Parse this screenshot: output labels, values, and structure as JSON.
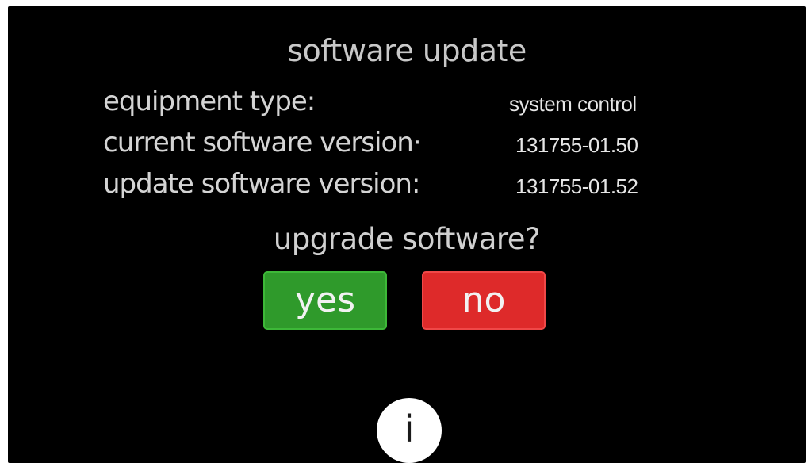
{
  "screen": {
    "title": "software update",
    "prompt": "upgrade software?"
  },
  "details": [
    {
      "label": "equipment type:",
      "value": "system control"
    },
    {
      "label": "current software version·",
      "value": "131755-01.50"
    },
    {
      "label": "update software version:",
      "value": "131755-01.52"
    }
  ],
  "buttons": {
    "yes_label": "yes",
    "no_label": "no",
    "yes_color": "#2f9a2b",
    "no_color": "#de2a2a"
  },
  "info": {
    "icon": "info-icon",
    "glyph": "i"
  },
  "colors": {
    "background": "#000000",
    "text": "#d4d4d4"
  }
}
